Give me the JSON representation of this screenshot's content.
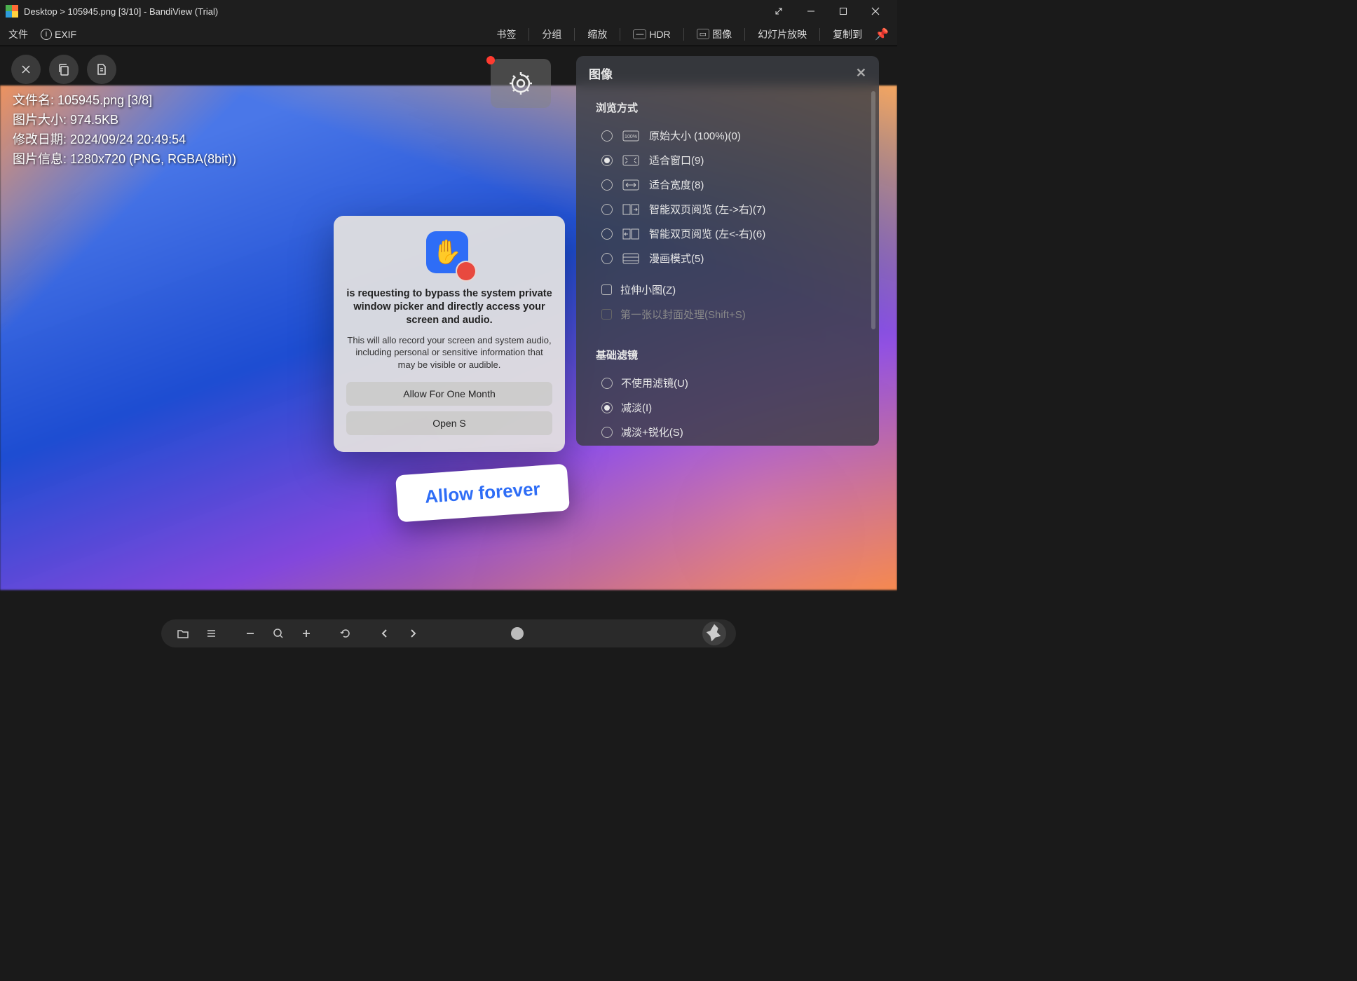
{
  "titlebar": {
    "path": "Desktop",
    "sep": ">",
    "filename": "105945.png",
    "counter": "[3/10]",
    "dash": "-",
    "app": "BandiView (Trial)"
  },
  "menu": {
    "file": "文件",
    "exif": "EXIF",
    "bookmark": "书签",
    "group": "分组",
    "zoom": "缩放",
    "hdr": "HDR",
    "image": "图像",
    "slideshow": "幻灯片放映",
    "copyto": "复制到"
  },
  "info": {
    "l1": "文件名: 105945.png [3/8]",
    "l2": "图片大小: 974.5KB",
    "l3": "修改日期: 2024/09/24 20:49:54",
    "l4": "图片信息: 1280x720 (PNG, RGBA(8bit))"
  },
  "macdialog": {
    "title": "is requesting to bypass the system private window picker and directly access your screen and audio.",
    "body": "This will allo          record your screen and system audio, including personal or sensitive information that may be visible or audible.",
    "btn1": "Allow For One Month",
    "btn2": "Open S"
  },
  "bubble": "Allow forever",
  "panel": {
    "title": "图像",
    "sec_view": "浏览方式",
    "opts": [
      {
        "label": "原始大小 (100%)",
        "key": "(0)"
      },
      {
        "label": "适合窗口",
        "key": "(9)"
      },
      {
        "label": "适合宽度",
        "key": "(8)"
      },
      {
        "label": "智能双页阅览 (左->右)",
        "key": "(7)"
      },
      {
        "label": "智能双页阅览 (左<-右)",
        "key": "(6)"
      },
      {
        "label": "漫画模式",
        "key": "(5)"
      }
    ],
    "chk_stretch": "拉伸小图",
    "chk_stretch_key": "(Z)",
    "chk_cover": "第一张以封面处理(Shift+S)",
    "sec_filter": "基础滤镜",
    "filters": [
      {
        "label": "不使用滤镜",
        "key": "(U)"
      },
      {
        "label": "减淡",
        "key": "(I)"
      },
      {
        "label": "减淡+锐化",
        "key": "(S)"
      }
    ]
  }
}
